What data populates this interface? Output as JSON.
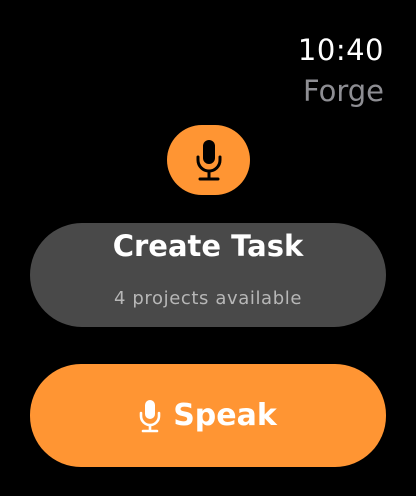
{
  "status": {
    "time": "10:40"
  },
  "app": {
    "title": "Forge",
    "badge_icon": "microphone-icon"
  },
  "create_task": {
    "title": "Create Task",
    "subtitle": "4 projects available"
  },
  "speak_button": {
    "label": "Speak",
    "icon": "microphone-icon"
  },
  "colors": {
    "background": "#000000",
    "accent": "#ff9533",
    "card": "#494949",
    "secondary_text": "#8e8e93",
    "subtitle_text": "#b7b7b7"
  }
}
